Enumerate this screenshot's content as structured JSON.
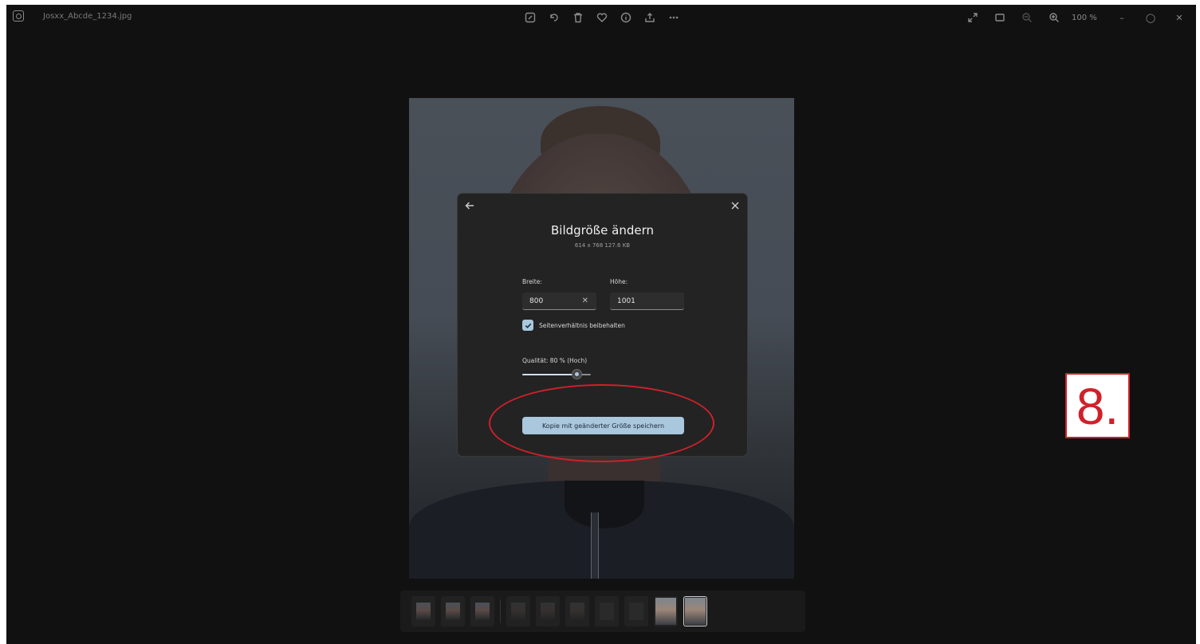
{
  "titlebar": {
    "filename": "Josxx_Abcde_1234.jpg",
    "zoom_level": "100 %"
  },
  "dialog": {
    "title": "Bildgröße ändern",
    "subtitle": "614 x 768   127.6 KB",
    "width_label": "Breite:",
    "width_value": "800",
    "height_label": "Höhe:",
    "height_value": "1001",
    "aspect_label": "Seitenverhältnis beibehalten",
    "aspect_checked": true,
    "quality_label": "Qualität: 80 % (Hoch)",
    "quality_value": 0.8,
    "save_label": "Kopie mit geänderter Größe speichern"
  },
  "filmstrip": {
    "thumbnails": [
      "photo",
      "photo",
      "photo",
      "photo-dim",
      "photo-dim",
      "photo-dim",
      "dark",
      "dark",
      "photo-bright",
      "photo-bright-selected"
    ]
  },
  "annotation": {
    "step": "8.",
    "accent_color": "#d0202a"
  }
}
